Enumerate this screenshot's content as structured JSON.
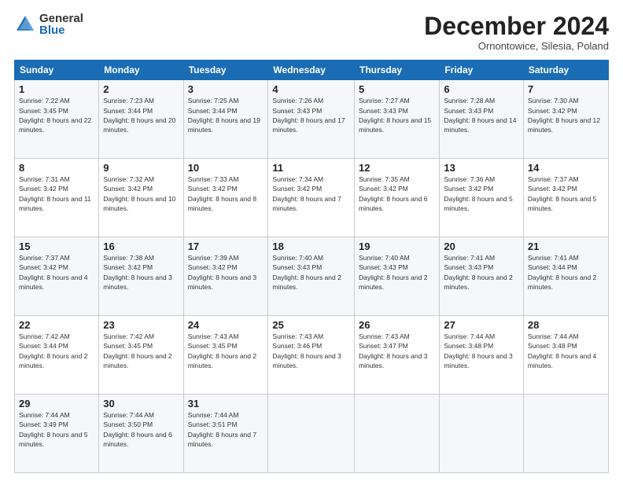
{
  "header": {
    "logo_general": "General",
    "logo_blue": "Blue",
    "month_title": "December 2024",
    "location": "Ornontowice, Silesia, Poland"
  },
  "days_of_week": [
    "Sunday",
    "Monday",
    "Tuesday",
    "Wednesday",
    "Thursday",
    "Friday",
    "Saturday"
  ],
  "weeks": [
    [
      {
        "day": "1",
        "sunrise": "7:22 AM",
        "sunset": "3:45 PM",
        "daylight": "8 hours and 22 minutes."
      },
      {
        "day": "2",
        "sunrise": "7:23 AM",
        "sunset": "3:44 PM",
        "daylight": "8 hours and 20 minutes."
      },
      {
        "day": "3",
        "sunrise": "7:25 AM",
        "sunset": "3:44 PM",
        "daylight": "8 hours and 19 minutes."
      },
      {
        "day": "4",
        "sunrise": "7:26 AM",
        "sunset": "3:43 PM",
        "daylight": "8 hours and 17 minutes."
      },
      {
        "day": "5",
        "sunrise": "7:27 AM",
        "sunset": "3:43 PM",
        "daylight": "8 hours and 15 minutes."
      },
      {
        "day": "6",
        "sunrise": "7:28 AM",
        "sunset": "3:43 PM",
        "daylight": "8 hours and 14 minutes."
      },
      {
        "day": "7",
        "sunrise": "7:30 AM",
        "sunset": "3:42 PM",
        "daylight": "8 hours and 12 minutes."
      }
    ],
    [
      {
        "day": "8",
        "sunrise": "7:31 AM",
        "sunset": "3:42 PM",
        "daylight": "8 hours and 11 minutes."
      },
      {
        "day": "9",
        "sunrise": "7:32 AM",
        "sunset": "3:42 PM",
        "daylight": "8 hours and 10 minutes."
      },
      {
        "day": "10",
        "sunrise": "7:33 AM",
        "sunset": "3:42 PM",
        "daylight": "8 hours and 8 minutes."
      },
      {
        "day": "11",
        "sunrise": "7:34 AM",
        "sunset": "3:42 PM",
        "daylight": "8 hours and 7 minutes."
      },
      {
        "day": "12",
        "sunrise": "7:35 AM",
        "sunset": "3:42 PM",
        "daylight": "8 hours and 6 minutes."
      },
      {
        "day": "13",
        "sunrise": "7:36 AM",
        "sunset": "3:42 PM",
        "daylight": "8 hours and 5 minutes."
      },
      {
        "day": "14",
        "sunrise": "7:37 AM",
        "sunset": "3:42 PM",
        "daylight": "8 hours and 5 minutes."
      }
    ],
    [
      {
        "day": "15",
        "sunrise": "7:37 AM",
        "sunset": "3:42 PM",
        "daylight": "8 hours and 4 minutes."
      },
      {
        "day": "16",
        "sunrise": "7:38 AM",
        "sunset": "3:42 PM",
        "daylight": "8 hours and 3 minutes."
      },
      {
        "day": "17",
        "sunrise": "7:39 AM",
        "sunset": "3:42 PM",
        "daylight": "8 hours and 3 minutes."
      },
      {
        "day": "18",
        "sunrise": "7:40 AM",
        "sunset": "3:43 PM",
        "daylight": "8 hours and 2 minutes."
      },
      {
        "day": "19",
        "sunrise": "7:40 AM",
        "sunset": "3:43 PM",
        "daylight": "8 hours and 2 minutes."
      },
      {
        "day": "20",
        "sunrise": "7:41 AM",
        "sunset": "3:43 PM",
        "daylight": "8 hours and 2 minutes."
      },
      {
        "day": "21",
        "sunrise": "7:41 AM",
        "sunset": "3:44 PM",
        "daylight": "8 hours and 2 minutes."
      }
    ],
    [
      {
        "day": "22",
        "sunrise": "7:42 AM",
        "sunset": "3:44 PM",
        "daylight": "8 hours and 2 minutes."
      },
      {
        "day": "23",
        "sunrise": "7:42 AM",
        "sunset": "3:45 PM",
        "daylight": "8 hours and 2 minutes."
      },
      {
        "day": "24",
        "sunrise": "7:43 AM",
        "sunset": "3:45 PM",
        "daylight": "8 hours and 2 minutes."
      },
      {
        "day": "25",
        "sunrise": "7:43 AM",
        "sunset": "3:46 PM",
        "daylight": "8 hours and 3 minutes."
      },
      {
        "day": "26",
        "sunrise": "7:43 AM",
        "sunset": "3:47 PM",
        "daylight": "8 hours and 3 minutes."
      },
      {
        "day": "27",
        "sunrise": "7:44 AM",
        "sunset": "3:48 PM",
        "daylight": "8 hours and 3 minutes."
      },
      {
        "day": "28",
        "sunrise": "7:44 AM",
        "sunset": "3:48 PM",
        "daylight": "8 hours and 4 minutes."
      }
    ],
    [
      {
        "day": "29",
        "sunrise": "7:44 AM",
        "sunset": "3:49 PM",
        "daylight": "8 hours and 5 minutes."
      },
      {
        "day": "30",
        "sunrise": "7:44 AM",
        "sunset": "3:50 PM",
        "daylight": "8 hours and 6 minutes."
      },
      {
        "day": "31",
        "sunrise": "7:44 AM",
        "sunset": "3:51 PM",
        "daylight": "8 hours and 7 minutes."
      },
      null,
      null,
      null,
      null
    ]
  ],
  "labels": {
    "sunrise": "Sunrise:",
    "sunset": "Sunset:",
    "daylight": "Daylight:"
  }
}
